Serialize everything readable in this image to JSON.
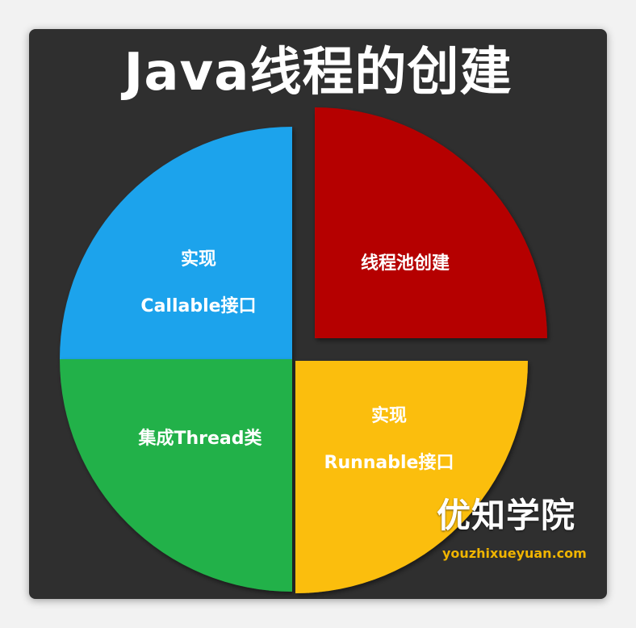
{
  "title": "Java线程的创建",
  "quadrants": {
    "top_left": {
      "lines": [
        "实现",
        "Callable接口"
      ],
      "color": "#1aa3ec"
    },
    "top_right": {
      "lines": [
        "线程池创建"
      ],
      "color": "#b50000"
    },
    "bottom_left": {
      "lines": [
        "集成Thread类"
      ],
      "color": "#21b14a"
    },
    "bottom_right": {
      "lines": [
        "实现",
        "Runnable接口"
      ],
      "color": "#fbbe0d"
    }
  },
  "watermark": {
    "name": "优知学院",
    "url": "youzhixueyuan.com",
    "url_color": "#f0b400"
  },
  "colors": {
    "background": "#2f2f2f",
    "page": "#f2f2f2"
  }
}
